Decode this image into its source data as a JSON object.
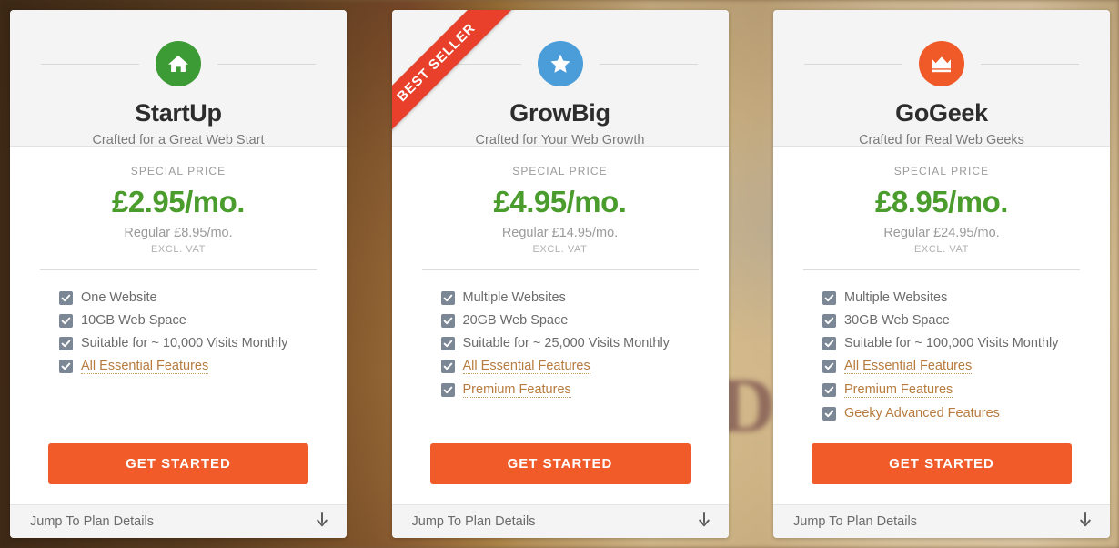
{
  "background": {
    "blurred_text": "Do"
  },
  "colors": {
    "startup_icon": "#3d9b35",
    "growbig_icon": "#4a9dd8",
    "gogeek_icon": "#f05a28",
    "price_green": "#4a9c2d",
    "cta_orange": "#f15a29",
    "ribbon_red": "#e8402a",
    "checkbox_grey": "#7c8796",
    "tooltip_link": "#b77b3e"
  },
  "plans": [
    {
      "id": "startup",
      "icon_name": "home-icon",
      "name": "StartUp",
      "tagline": "Crafted for a Great Web Start",
      "ribbon": null,
      "special_label": "SPECIAL PRICE",
      "price": "£2.95/mo.",
      "regular": "Regular £8.95/mo.",
      "vat": "EXCL. VAT",
      "features": [
        {
          "label": "One Website",
          "link": false
        },
        {
          "label": "10GB Web Space",
          "link": false
        },
        {
          "label": "Suitable for ~ 10,000 Visits Monthly",
          "link": false
        },
        {
          "label": "All Essential Features",
          "link": true
        }
      ],
      "cta": "GET STARTED",
      "footer": "Jump To Plan Details"
    },
    {
      "id": "growbig",
      "icon_name": "star-icon",
      "name": "GrowBig",
      "tagline": "Crafted for Your Web Growth",
      "ribbon": "BEST SELLER",
      "special_label": "SPECIAL PRICE",
      "price": "£4.95/mo.",
      "regular": "Regular £14.95/mo.",
      "vat": "EXCL. VAT",
      "features": [
        {
          "label": "Multiple Websites",
          "link": false
        },
        {
          "label": "20GB Web Space",
          "link": false
        },
        {
          "label": "Suitable for ~ 25,000 Visits Monthly",
          "link": false
        },
        {
          "label": "All Essential Features",
          "link": true
        },
        {
          "label": "Premium Features",
          "link": true
        }
      ],
      "cta": "GET STARTED",
      "footer": "Jump To Plan Details"
    },
    {
      "id": "gogeek",
      "icon_name": "crown-icon",
      "name": "GoGeek",
      "tagline": "Crafted for Real Web Geeks",
      "ribbon": null,
      "special_label": "SPECIAL PRICE",
      "price": "£8.95/mo.",
      "regular": "Regular £24.95/mo.",
      "vat": "EXCL. VAT",
      "features": [
        {
          "label": "Multiple Websites",
          "link": false
        },
        {
          "label": "30GB Web Space",
          "link": false
        },
        {
          "label": "Suitable for ~ 100,000 Visits Monthly",
          "link": false
        },
        {
          "label": "All Essential Features",
          "link": true
        },
        {
          "label": "Premium Features",
          "link": true
        },
        {
          "label": "Geeky Advanced Features",
          "link": true
        }
      ],
      "cta": "GET STARTED",
      "footer": "Jump To Plan Details"
    }
  ]
}
